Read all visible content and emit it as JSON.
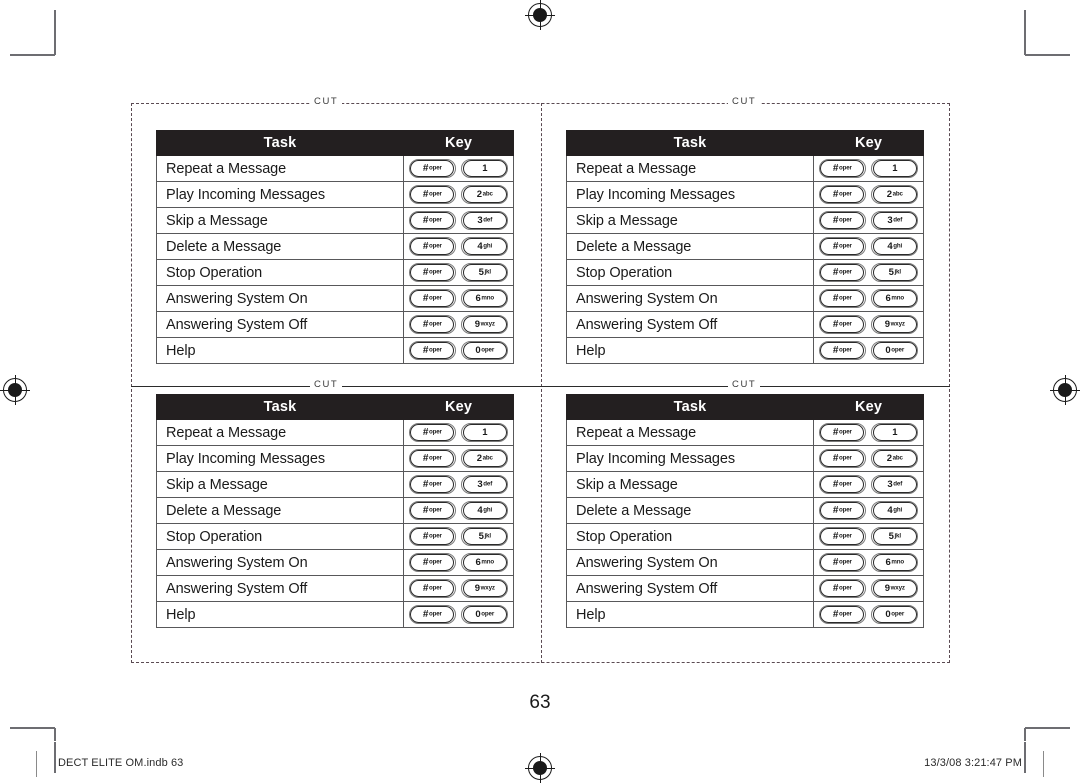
{
  "document": {
    "page_number": "63",
    "footer_left": "DECT ELITE OM.indb   63",
    "footer_right": "13/3/08   3:21:47 PM"
  },
  "cut_label": "CUT",
  "colors": {
    "header_background": "#231f20",
    "header_text": "#ffffff",
    "table_border": "#58585a",
    "cut_line": "#5a4a52",
    "body_text": "#1a1a1a"
  },
  "table": {
    "columns": [
      "Task",
      "Key"
    ],
    "rows": [
      {
        "task": "Repeat a Message",
        "keys": [
          {
            "glyph": "#",
            "sub": "oper"
          },
          {
            "glyph": "1",
            "sub": ""
          }
        ]
      },
      {
        "task": "Play Incoming Messages",
        "keys": [
          {
            "glyph": "#",
            "sub": "oper"
          },
          {
            "glyph": "2",
            "sub": "abc"
          }
        ]
      },
      {
        "task": "Skip a Message",
        "keys": [
          {
            "glyph": "#",
            "sub": "oper"
          },
          {
            "glyph": "3",
            "sub": "def"
          }
        ]
      },
      {
        "task": "Delete a Message",
        "keys": [
          {
            "glyph": "#",
            "sub": "oper"
          },
          {
            "glyph": "4",
            "sub": "ghi"
          }
        ]
      },
      {
        "task": "Stop Operation",
        "keys": [
          {
            "glyph": "#",
            "sub": "oper"
          },
          {
            "glyph": "5",
            "sub": "jkl"
          }
        ]
      },
      {
        "task": "Answering System On",
        "keys": [
          {
            "glyph": "#",
            "sub": "oper"
          },
          {
            "glyph": "6",
            "sub": "mno"
          }
        ]
      },
      {
        "task": "Answering System Off",
        "keys": [
          {
            "glyph": "#",
            "sub": "oper"
          },
          {
            "glyph": "9",
            "sub": "wxyz"
          }
        ]
      },
      {
        "task": "Help",
        "keys": [
          {
            "glyph": "#",
            "sub": "oper"
          },
          {
            "glyph": "0",
            "sub": "oper"
          }
        ]
      }
    ]
  },
  "cards": [
    {
      "id": "table-tl",
      "position": "top-left"
    },
    {
      "id": "table-tr",
      "position": "top-right"
    },
    {
      "id": "table-bl",
      "position": "bottom-left"
    },
    {
      "id": "table-br",
      "position": "bottom-right"
    }
  ]
}
